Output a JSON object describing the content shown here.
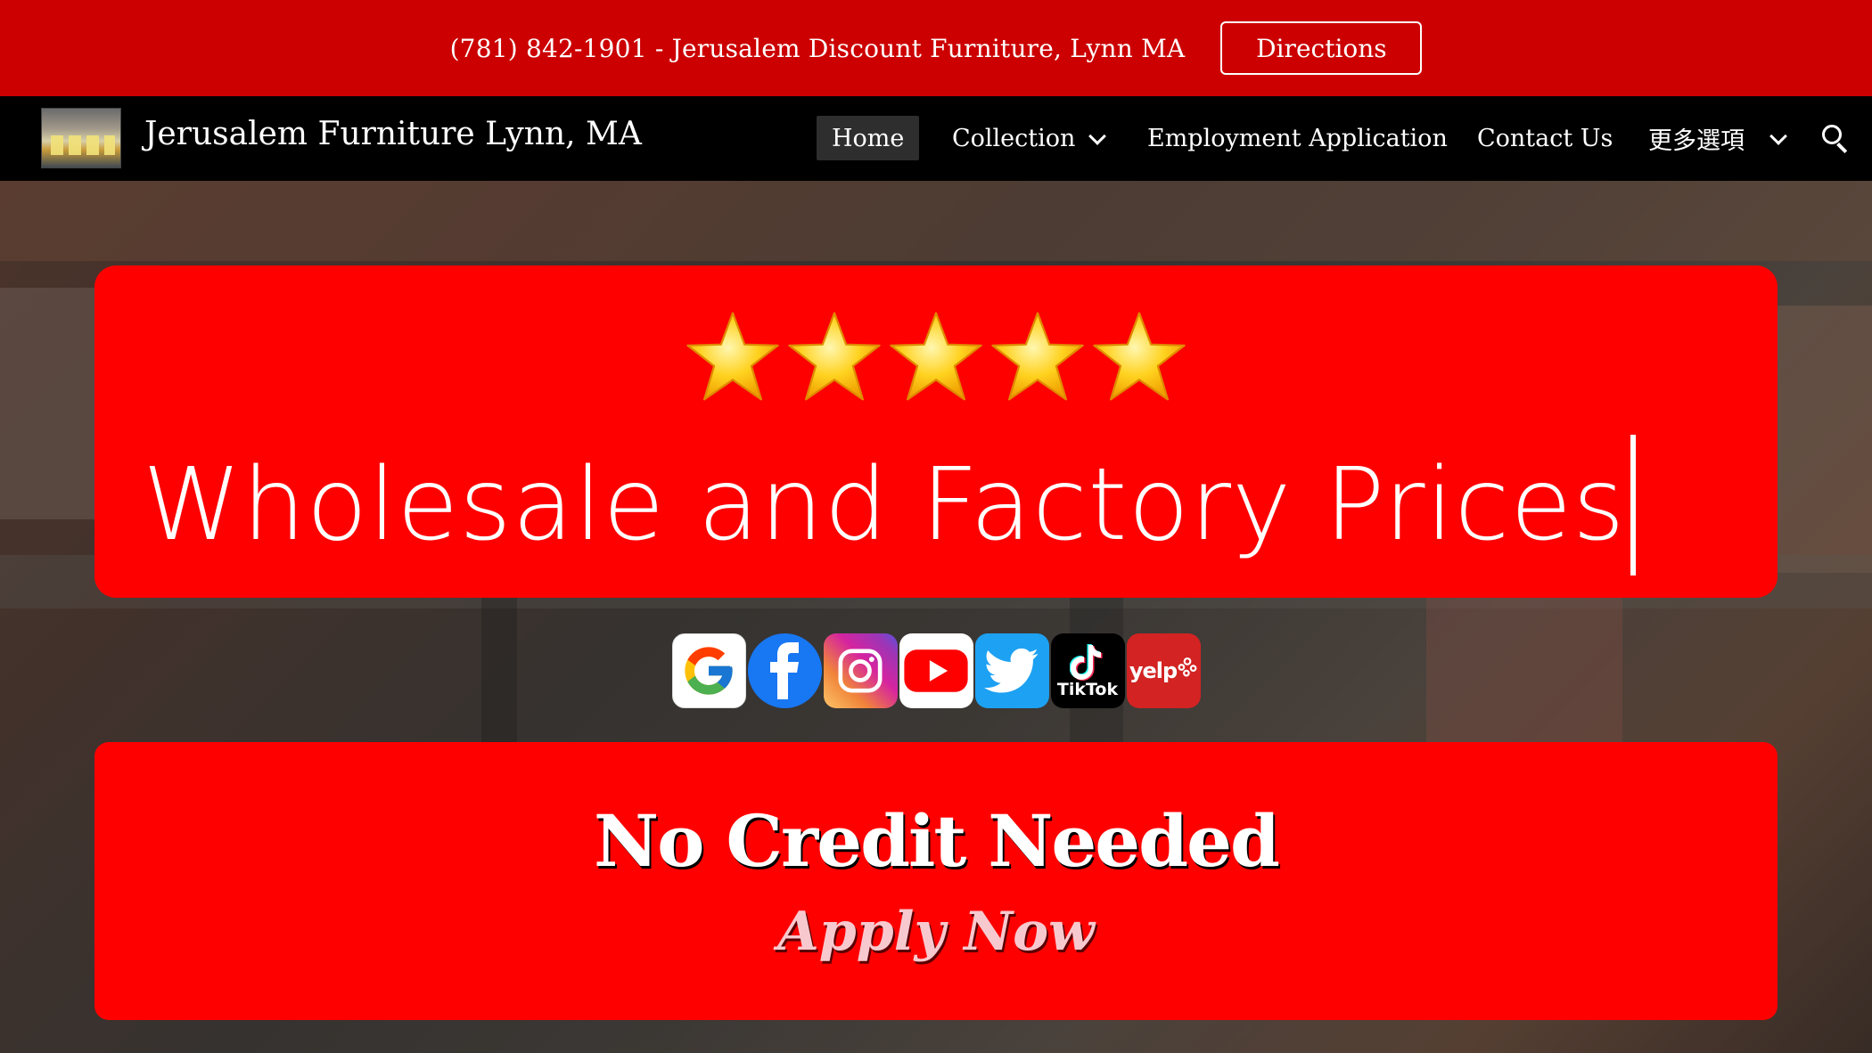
{
  "announcement": {
    "text": "(781) 842-1901 - Jerusalem Discount Furniture, Lynn MA",
    "directions_label": "Directions"
  },
  "nav": {
    "site_title": "Jerusalem Furniture Lynn, MA",
    "items": [
      {
        "label": "Home",
        "active": true,
        "has_dropdown": false
      },
      {
        "label": "Collection",
        "active": false,
        "has_dropdown": true
      },
      {
        "label": "Employment Application",
        "active": false,
        "has_dropdown": false
      },
      {
        "label": "Contact Us",
        "active": false,
        "has_dropdown": false
      },
      {
        "label": "更多選項",
        "active": false,
        "has_dropdown": true
      }
    ],
    "search_icon": "search-icon"
  },
  "hero": {
    "rating_stars": 5,
    "headline": "Wholesale and Factory Prices",
    "social_icons": [
      "google-icon",
      "facebook-icon",
      "instagram-icon",
      "youtube-icon",
      "twitter-icon",
      "tiktok-icon",
      "yelp-icon"
    ],
    "tiktok_label": "TikTok",
    "yelp_label": "yelp"
  },
  "credit": {
    "headline": "No Credit Needed",
    "cta": "Apply Now"
  },
  "colors": {
    "announce_bar": "#cc0000",
    "panel_red": "#ff0000",
    "nav_bg": "#000000"
  }
}
